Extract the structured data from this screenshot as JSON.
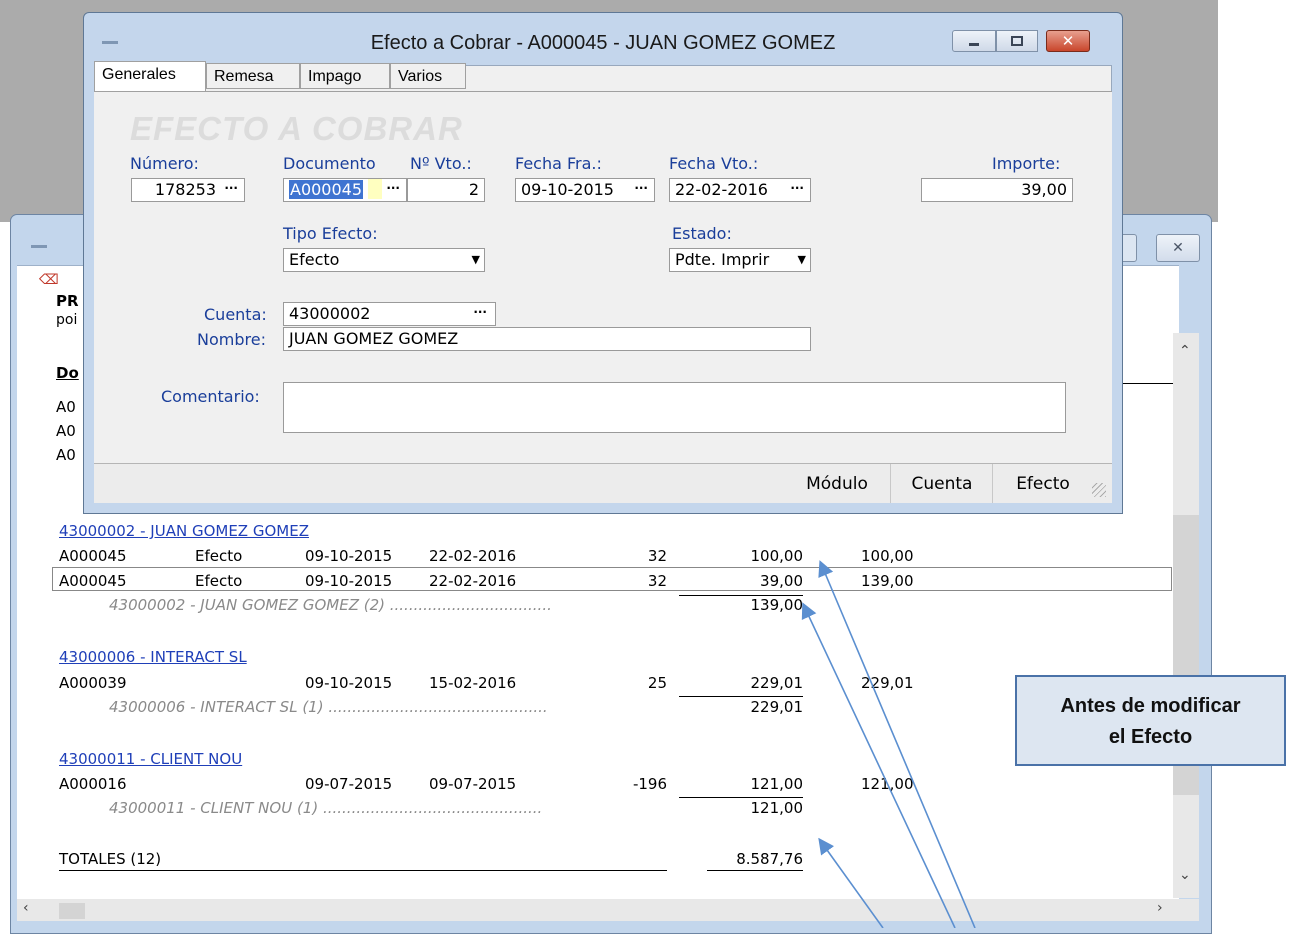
{
  "dialog": {
    "title": "Efecto a Cobrar - A000045 - JUAN GOMEZ GOMEZ",
    "tabs": [
      "Generales",
      "Remesa",
      "Impago",
      "Varios"
    ],
    "watermark": "EFECTO A COBRAR",
    "labels": {
      "numero": "Número:",
      "documento": "Documento",
      "nvto": "Nº Vto.:",
      "fecha_fra": "Fecha Fra.:",
      "fecha_vto": "Fecha Vto.:",
      "importe": "Importe:",
      "tipo_efecto": "Tipo Efecto:",
      "estado": "Estado:",
      "cuenta": "Cuenta:",
      "nombre": "Nombre:",
      "comentario": "Comentario:"
    },
    "values": {
      "numero": "178253",
      "documento": "A000045",
      "nvto": "2",
      "fecha_fra": "09-10-2015",
      "fecha_vto": "22-02-2016",
      "importe": "39,00",
      "tipo_efecto": "Efecto",
      "estado": "Pdte. Imprir",
      "cuenta": "43000002",
      "nombre": "JUAN GOMEZ GOMEZ",
      "comentario": ""
    },
    "status_buttons": [
      "Módulo",
      "Cuenta",
      "Efecto"
    ]
  },
  "report": {
    "left_fragments": {
      "pr": "PR",
      "por": "poi",
      "do": "Do",
      "a1": "A0",
      "a2": "A0",
      "a3": "A0"
    },
    "groups": [
      {
        "header": "43000002 - JUAN GOMEZ GOMEZ",
        "rows": [
          {
            "doc": "A000045",
            "tipo": "Efecto",
            "fra": "09-10-2015",
            "vto": "22-02-2016",
            "dias": "32",
            "importe": "100,00",
            "acum": "100,00"
          },
          {
            "doc": "A000045",
            "tipo": "Efecto",
            "fra": "09-10-2015",
            "vto": "22-02-2016",
            "dias": "32",
            "importe": "39,00",
            "acum": "139,00"
          }
        ],
        "subtotal_label": "43000002 - JUAN GOMEZ GOMEZ (2) ..................................",
        "subtotal": "139,00"
      },
      {
        "header": "43000006 - INTERACT SL",
        "rows": [
          {
            "doc": "A000039",
            "tipo": "",
            "fra": "09-10-2015",
            "vto": "15-02-2016",
            "dias": "25",
            "importe": "229,01",
            "acum": "229,01"
          }
        ],
        "subtotal_label": "43000006 - INTERACT SL (1) ..............................................",
        "subtotal": "229,01"
      },
      {
        "header": "43000011 - CLIENT NOU",
        "rows": [
          {
            "doc": "A000016",
            "tipo": "",
            "fra": "09-07-2015",
            "vto": "09-07-2015",
            "dias": "-196",
            "importe": "121,00",
            "acum": "121,00"
          }
        ],
        "subtotal_label": "43000011 - CLIENT NOU (1) ..............................................",
        "subtotal": "121,00"
      }
    ],
    "totals_label": "TOTALES (12)",
    "totals_value": "8.587,76"
  },
  "callout": {
    "line1": "Antes de modificar",
    "line2": "el Efecto"
  },
  "colors": {
    "label_blue": "#1a3e9a",
    "link_blue": "#1f3fb8",
    "window_frame": "#c4d6ec",
    "arrow": "#5b8fd0"
  }
}
